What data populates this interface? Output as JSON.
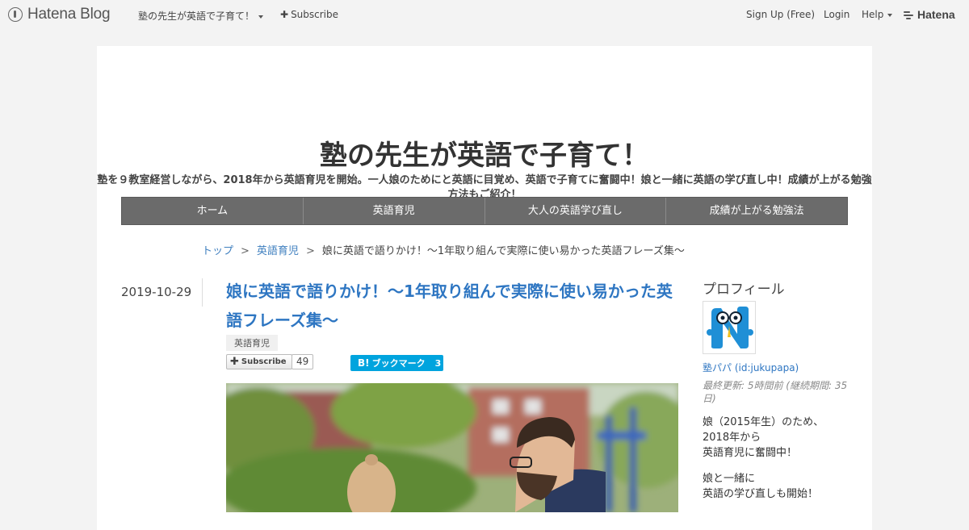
{
  "topbar": {
    "logo_text": "Hatena Blog",
    "blog_name": "塾の先生が英語で子育て！",
    "subscribe": "Subscribe",
    "signup": "Sign Up (Free)",
    "login": "Login",
    "help": "Help",
    "hatena": "Hatena"
  },
  "header": {
    "title": "塾の先生が英語で子育て！",
    "description": "塾を９教室経営しながら、2018年から英語育児を開始。一人娘のためにと英語に目覚め、英語で子育てに奮闘中！娘と一緒に英語の学び直し中！成績が上がる勉強方法もご紹介！"
  },
  "nav": {
    "items": [
      {
        "label": "ホーム"
      },
      {
        "label": "英語育児"
      },
      {
        "label": "大人の英語学び直し"
      },
      {
        "label": "成績が上がる勉強法"
      }
    ]
  },
  "breadcrumb": {
    "top": "トップ",
    "category": "英語育児",
    "current": "娘に英語で語りかけ！～1年取り組んで実際に使い易かった英語フレーズ集～",
    "separator": ">"
  },
  "entry": {
    "date": "2019-10-29",
    "title": "娘に英語で語りかけ！～1年取り組んで実際に使い易かった英語フレーズ集～",
    "category": "英語育児",
    "subscribe_label": "Subscribe",
    "subscribe_count": "49",
    "bookmark_label": "ブックマーク",
    "bookmark_count": "3"
  },
  "sidebar": {
    "heading": "プロフィール",
    "name": "塾パパ (id:jukupapa)",
    "meta": "最終更新: 5時間前 (継続期間: 35日)",
    "para1": [
      "娘（2015年生）のため、",
      "2018年から",
      "英語育児に奮闘中！"
    ],
    "para2": [
      "娘と一緒に",
      "英語の学び直しも開始！"
    ]
  },
  "colors": {
    "accent": "#2e76c2",
    "nav_bg": "#6b6b6b",
    "bookmark": "#00a4de"
  }
}
